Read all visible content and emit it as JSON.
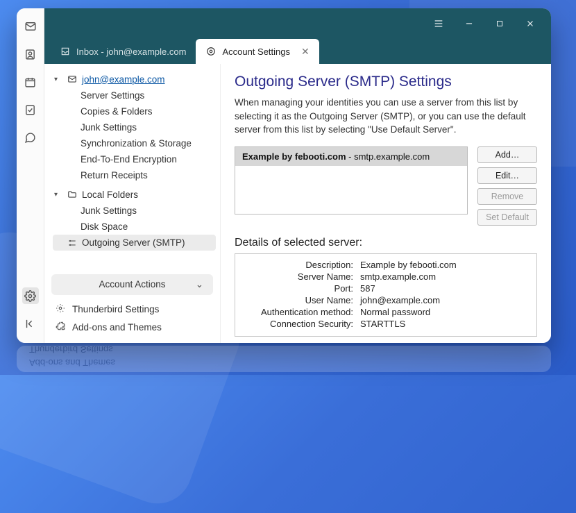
{
  "tabs": {
    "inbox": {
      "label": "Inbox - john@example.com"
    },
    "settings": {
      "label": "Account Settings"
    }
  },
  "sidebar": {
    "account_email": "john@example.com",
    "items": {
      "server_settings": "Server Settings",
      "copies_folders": "Copies & Folders",
      "junk": "Junk Settings",
      "sync": "Synchronization & Storage",
      "e2e": "End-To-End Encryption",
      "receipts": "Return Receipts"
    },
    "local_label": "Local Folders",
    "local_items": {
      "junk": "Junk Settings",
      "disk": "Disk Space",
      "smtp": "Outgoing Server (SMTP)"
    },
    "account_actions": "Account Actions",
    "thunderbird_settings": "Thunderbird Settings",
    "addons": "Add-ons and Themes"
  },
  "main": {
    "title": "Outgoing Server (SMTP) Settings",
    "description": "When managing your identities you can use a server from this list by selecting it as the Outgoing Server (SMTP), or you can use the default server from this list by selecting \"Use Default Server\".",
    "server_item_bold": "Example by febooti.com",
    "server_item_rest": " - smtp.example.com",
    "buttons": {
      "add": "Add…",
      "edit": "Edit…",
      "remove": "Remove",
      "set_default": "Set Default"
    },
    "details_title": "Details of selected server:",
    "details": {
      "description_k": "Description:",
      "description_v": "Example by febooti.com",
      "servername_k": "Server Name:",
      "servername_v": "smtp.example.com",
      "port_k": "Port:",
      "port_v": "587",
      "username_k": "User Name:",
      "username_v": "john@example.com",
      "auth_k": "Authentication method:",
      "auth_v": "Normal password",
      "sec_k": "Connection Security:",
      "sec_v": "STARTTLS"
    }
  }
}
